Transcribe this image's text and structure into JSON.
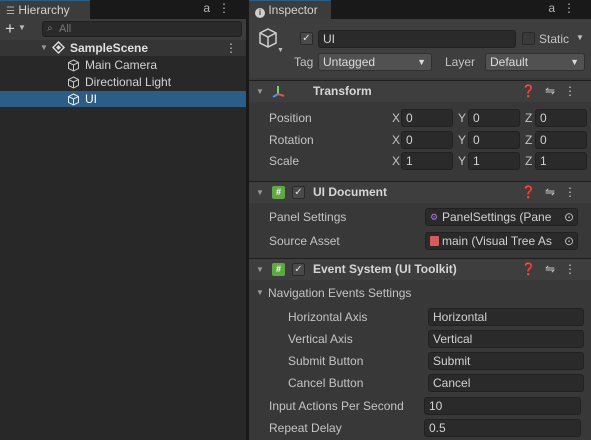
{
  "hierarchy": {
    "tab_title": "Hierarchy",
    "search_placeholder": "All",
    "add_label": "+",
    "scene": {
      "name": "SampleScene"
    },
    "items": [
      "Main Camera",
      "Directional Light",
      "UI"
    ],
    "selected": "UI"
  },
  "inspector": {
    "tab_title": "Inspector",
    "object": {
      "name": "UI",
      "active": true,
      "static_label": "Static",
      "tag_label": "Tag",
      "tag_value": "Untagged",
      "layer_label": "Layer",
      "layer_value": "Default"
    },
    "transform": {
      "title": "Transform",
      "rows": [
        {
          "label": "Position",
          "x": "0",
          "y": "0",
          "z": "0"
        },
        {
          "label": "Rotation",
          "x": "0",
          "y": "0",
          "z": "0"
        },
        {
          "label": "Scale",
          "x": "1",
          "y": "1",
          "z": "1"
        }
      ],
      "axis_x": "X",
      "axis_y": "Y",
      "axis_z": "Z"
    },
    "ui_document": {
      "title": "UI Document",
      "enabled": true,
      "panel_settings_label": "Panel Settings",
      "panel_settings_value": "PanelSettings (Pane",
      "source_asset_label": "Source Asset",
      "source_asset_value": "main (Visual Tree As"
    },
    "event_system": {
      "title": "Event System (UI Toolkit)",
      "enabled": true,
      "section_title": "Navigation Events Settings",
      "fields": [
        {
          "label": "Horizontal Axis",
          "value": "Horizontal"
        },
        {
          "label": "Vertical Axis",
          "value": "Vertical"
        },
        {
          "label": "Submit Button",
          "value": "Submit"
        },
        {
          "label": "Cancel Button",
          "value": "Cancel"
        }
      ],
      "input_actions_label": "Input Actions Per Second",
      "input_actions_value": "10",
      "repeat_delay_label": "Repeat Delay",
      "repeat_delay_value": "0.5"
    }
  },
  "colors": {
    "selection": "#2c5d87",
    "panel": "#383838",
    "field": "#2a2a2a"
  }
}
